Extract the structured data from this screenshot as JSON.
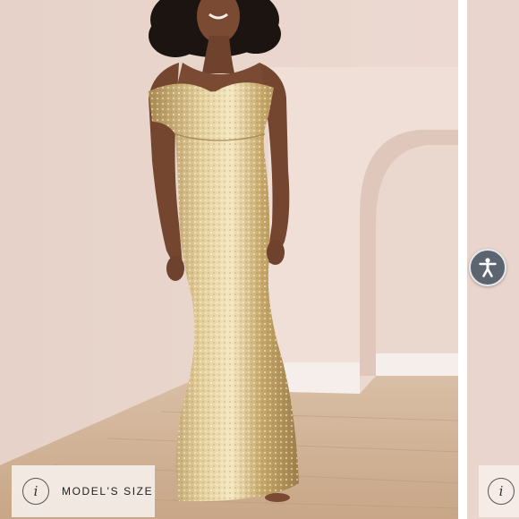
{
  "gallery": {
    "size_chip": {
      "label": "MODEL'S SIZE",
      "icon": "info-icon",
      "icon_glyph": "i"
    },
    "colors": {
      "wall": "#e9d5cd",
      "floor": "#c9a98a",
      "dress": "#c9a96a",
      "chip_bg": "#f5eee9",
      "accessibility_bg": "#5c6470"
    }
  },
  "accessibility": {
    "icon": "accessibility-icon"
  }
}
